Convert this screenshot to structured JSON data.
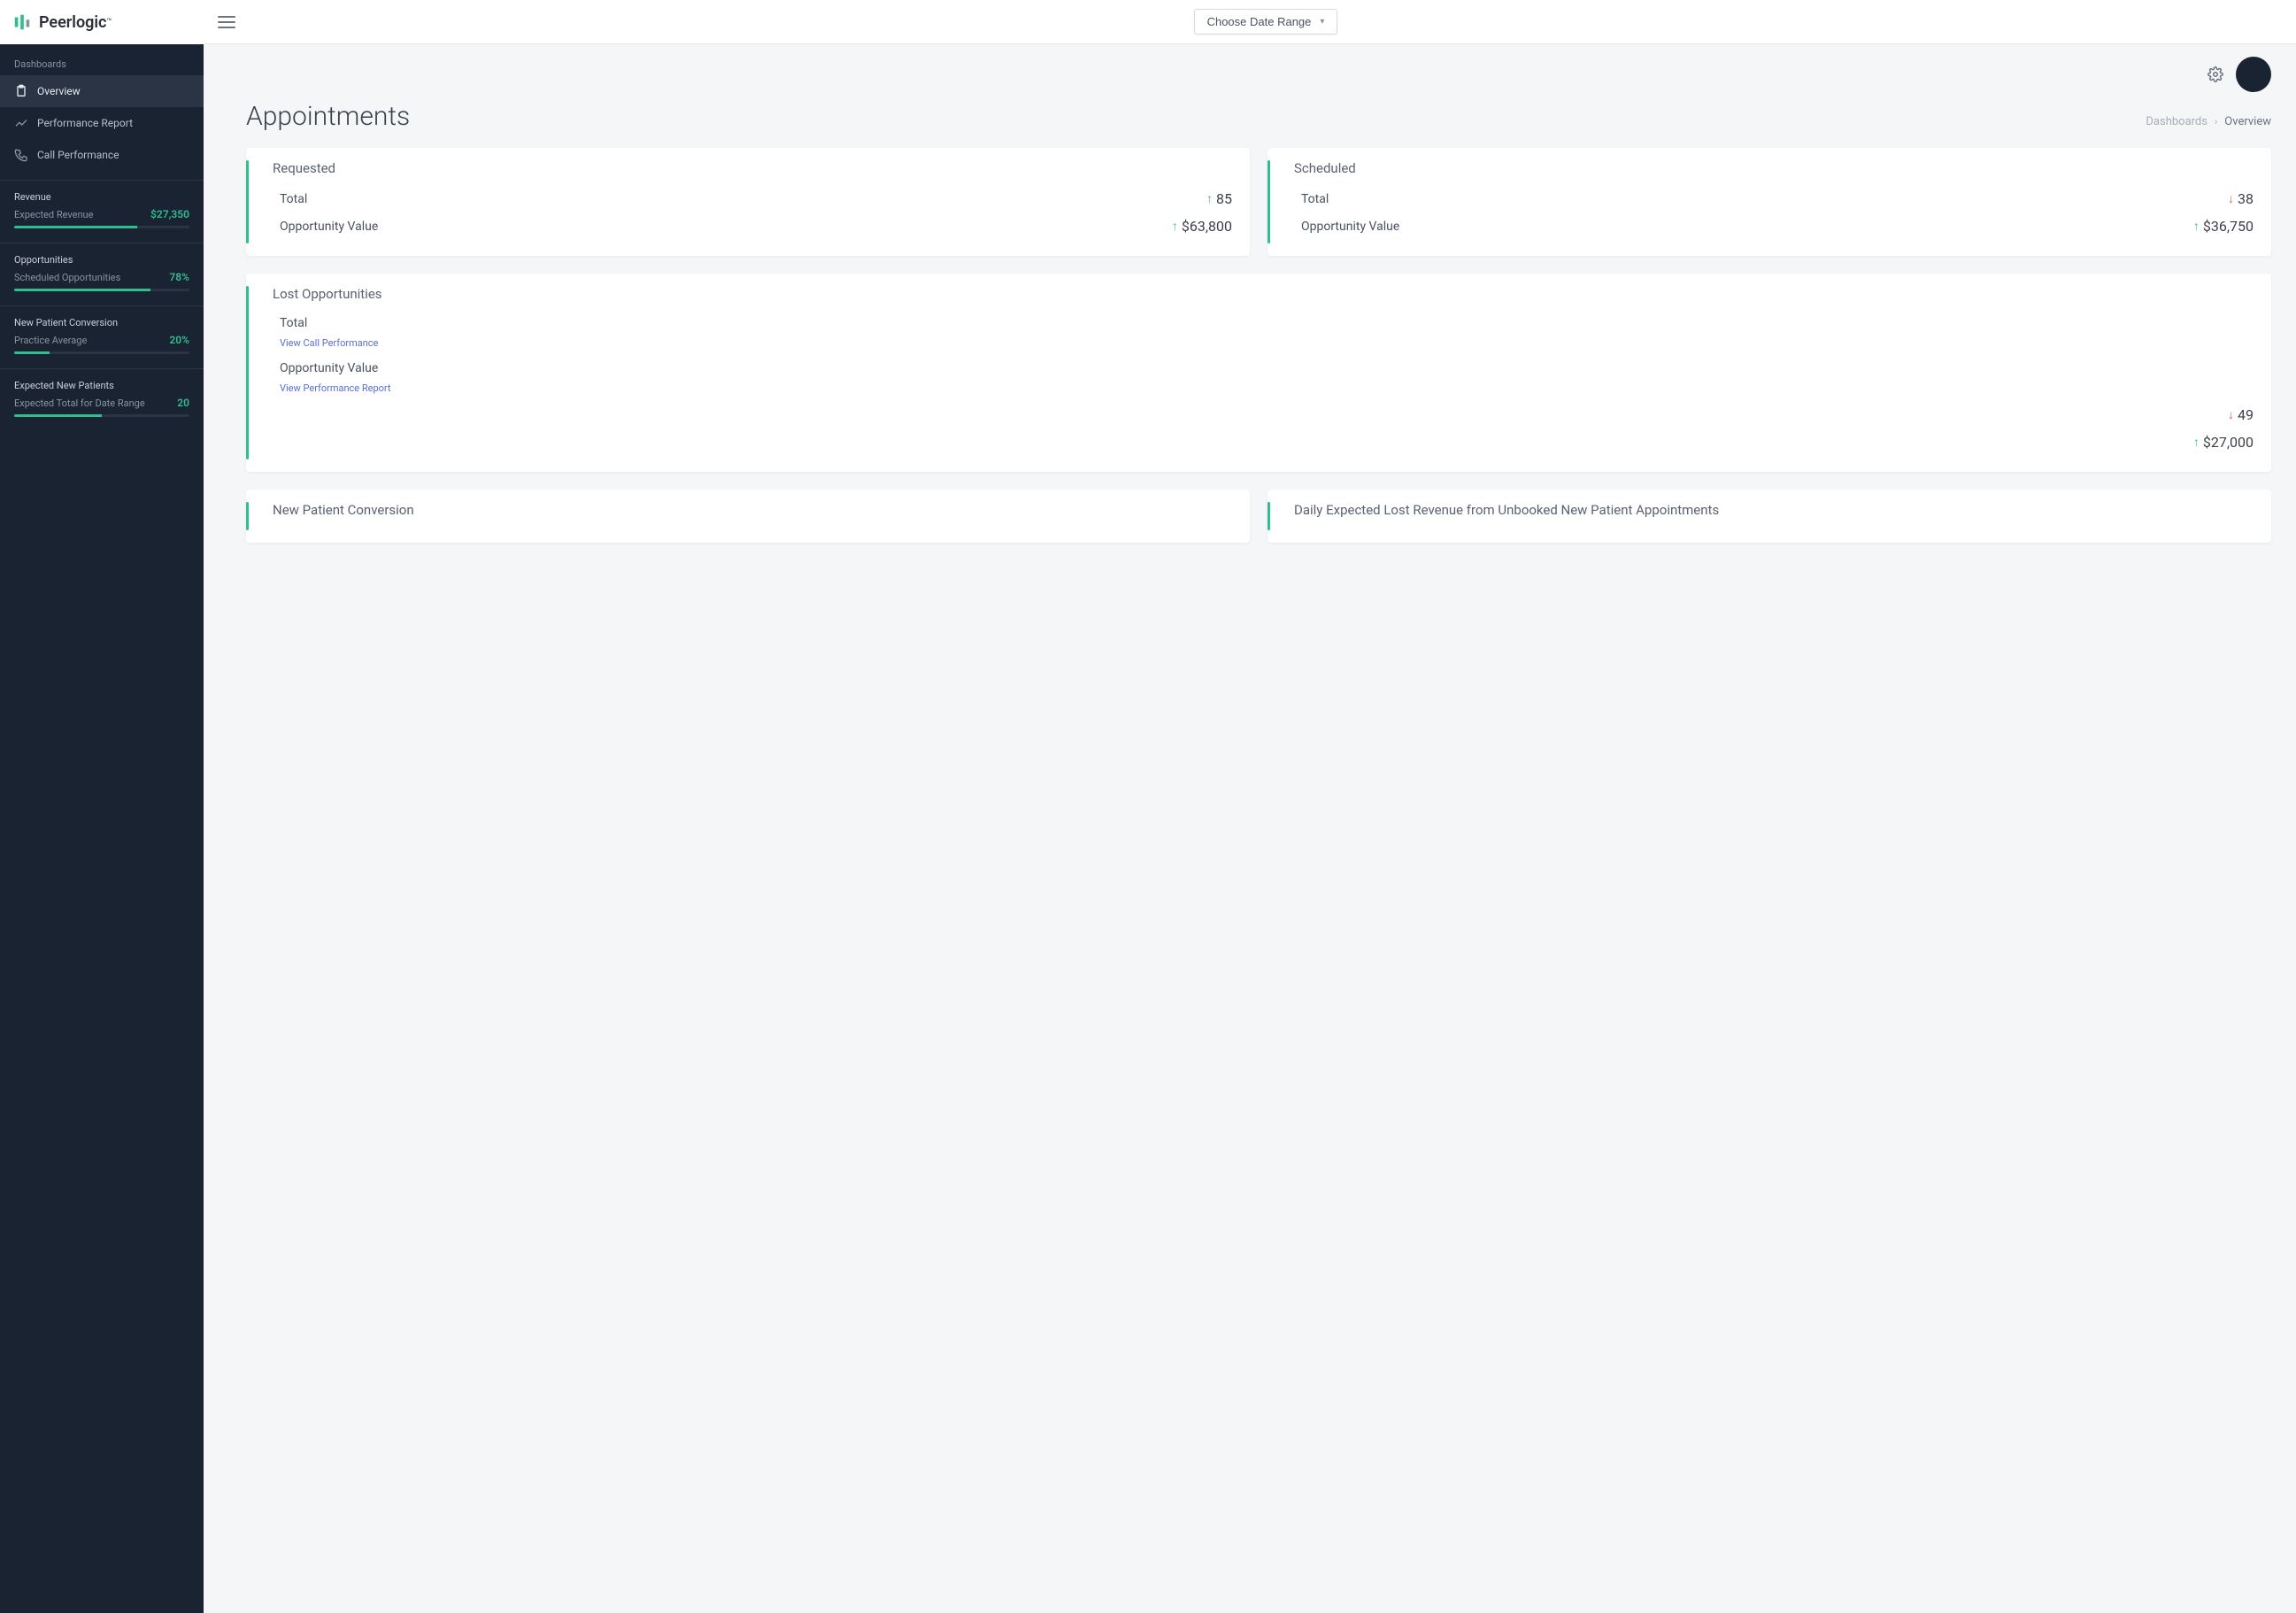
{
  "brand": {
    "name": "Peerlogic",
    "tm": "™"
  },
  "sidebar": {
    "section_label": "Dashboards",
    "items": [
      {
        "label": "Overview",
        "active": true
      },
      {
        "label": "Performance Report",
        "active": false
      },
      {
        "label": "Call Performance",
        "active": false
      }
    ],
    "metrics": [
      {
        "heading": "Revenue",
        "label": "Expected Revenue",
        "value": "$27,350",
        "fill": 70
      },
      {
        "heading": "Opportunities",
        "label": "Scheduled Opportunities",
        "value": "78%",
        "fill": 78
      },
      {
        "heading": "New Patient Conversion",
        "label": "Practice Average",
        "value": "20%",
        "fill": 20
      },
      {
        "heading": "Expected New Patients",
        "label": "Expected Total for Date Range",
        "value": "20",
        "fill": 50
      }
    ]
  },
  "topbar": {
    "date_label": "Choose Date Range"
  },
  "breadcrumb": {
    "root": "Dashboards",
    "current": "Overview"
  },
  "page": {
    "title": "Appointments"
  },
  "cards": {
    "requested": {
      "title": "Requested",
      "total_label": "Total",
      "total_value": "85",
      "total_dir": "up",
      "opp_label": "Opportunity Value",
      "opp_value": "$63,800",
      "opp_dir": "up"
    },
    "scheduled": {
      "title": "Scheduled",
      "total_label": "Total",
      "total_value": "38",
      "total_dir": "down",
      "opp_label": "Opportunity Value",
      "opp_value": "$36,750",
      "opp_dir": "up"
    },
    "lost": {
      "title": "Lost Opportunities",
      "total_label": "Total",
      "link1": "View Call Performance",
      "opp_label": "Opportunity Value",
      "link2": "View Performance Report",
      "val1": "49",
      "val1_dir": "down",
      "val2": "$27,000",
      "val2_dir": "up"
    },
    "npc": {
      "title": "New Patient Conversion"
    },
    "daily": {
      "title": "Daily Expected Lost Revenue from Unbooked New Patient Appointments"
    }
  }
}
